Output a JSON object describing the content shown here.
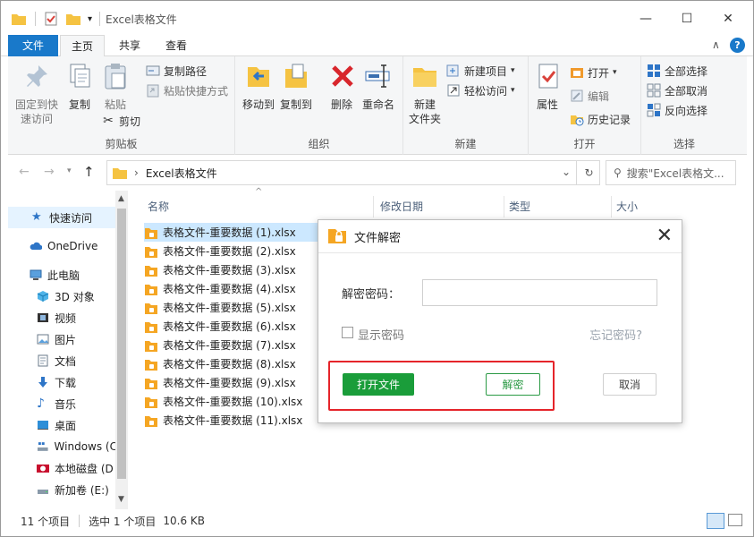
{
  "window": {
    "title": "Excel表格文件",
    "controls": [
      "—",
      "☐",
      "✕"
    ]
  },
  "tabs": {
    "file": "文件",
    "home": "主页",
    "share": "共享",
    "view": "查看"
  },
  "ribbon": {
    "clipboard": {
      "pin_label_1": "固定到快",
      "pin_label_2": "速访问",
      "copy": "复制",
      "paste": "粘贴",
      "copy_path": "复制路径",
      "paste_shortcut": "粘贴快捷方式",
      "cut": "剪切",
      "group": "剪贴板"
    },
    "organize": {
      "move_to": "移动到",
      "copy_to": "复制到",
      "delete": "删除",
      "rename": "重命名",
      "group": "组织"
    },
    "new": {
      "new_folder_1": "新建",
      "new_folder_2": "文件夹",
      "new_item": "新建项目",
      "easy_access": "轻松访问",
      "group": "新建"
    },
    "open": {
      "properties": "属性",
      "open": "打开",
      "edit": "编辑",
      "history": "历史记录",
      "group": "打开"
    },
    "select": {
      "select_all": "全部选择",
      "select_none": "全部取消",
      "invert": "反向选择",
      "group": "选择"
    }
  },
  "address": {
    "path": "Excel表格文件",
    "search_placeholder": "搜索\"Excel表格文..."
  },
  "nav": {
    "items": [
      {
        "label": "快速访问"
      },
      {
        "label": "OneDrive"
      },
      {
        "label": "此电脑"
      },
      {
        "label": "3D 对象"
      },
      {
        "label": "视频"
      },
      {
        "label": "图片"
      },
      {
        "label": "文档"
      },
      {
        "label": "下载"
      },
      {
        "label": "音乐"
      },
      {
        "label": "桌面"
      },
      {
        "label": "Windows (C"
      },
      {
        "label": "本地磁盘 (D"
      },
      {
        "label": "新加卷 (E:)"
      }
    ]
  },
  "columns": {
    "name": "名称",
    "date": "修改日期",
    "type": "类型",
    "size": "大小"
  },
  "files": [
    "表格文件-重要数据 (1).xlsx",
    "表格文件-重要数据 (2).xlsx",
    "表格文件-重要数据 (3).xlsx",
    "表格文件-重要数据 (4).xlsx",
    "表格文件-重要数据 (5).xlsx",
    "表格文件-重要数据 (6).xlsx",
    "表格文件-重要数据 (7).xlsx",
    "表格文件-重要数据 (8).xlsx",
    "表格文件-重要数据 (9).xlsx",
    "表格文件-重要数据 (10).xlsx",
    "表格文件-重要数据 (11).xlsx"
  ],
  "status": {
    "count": "11 个项目",
    "selected": "选中 1 个项目",
    "size": "10.6 KB"
  },
  "dialog": {
    "title": "文件解密",
    "password_label": "解密密码：",
    "password_value": "",
    "show_password": "显示密码",
    "forgot": "忘记密码?",
    "open_file": "打开文件",
    "decrypt": "解密",
    "cancel": "取消"
  },
  "colors": {
    "accent": "#1979ca",
    "green": "#1a9d3a",
    "highlight": "#e5242a",
    "selected_row": "#cce8ff"
  }
}
